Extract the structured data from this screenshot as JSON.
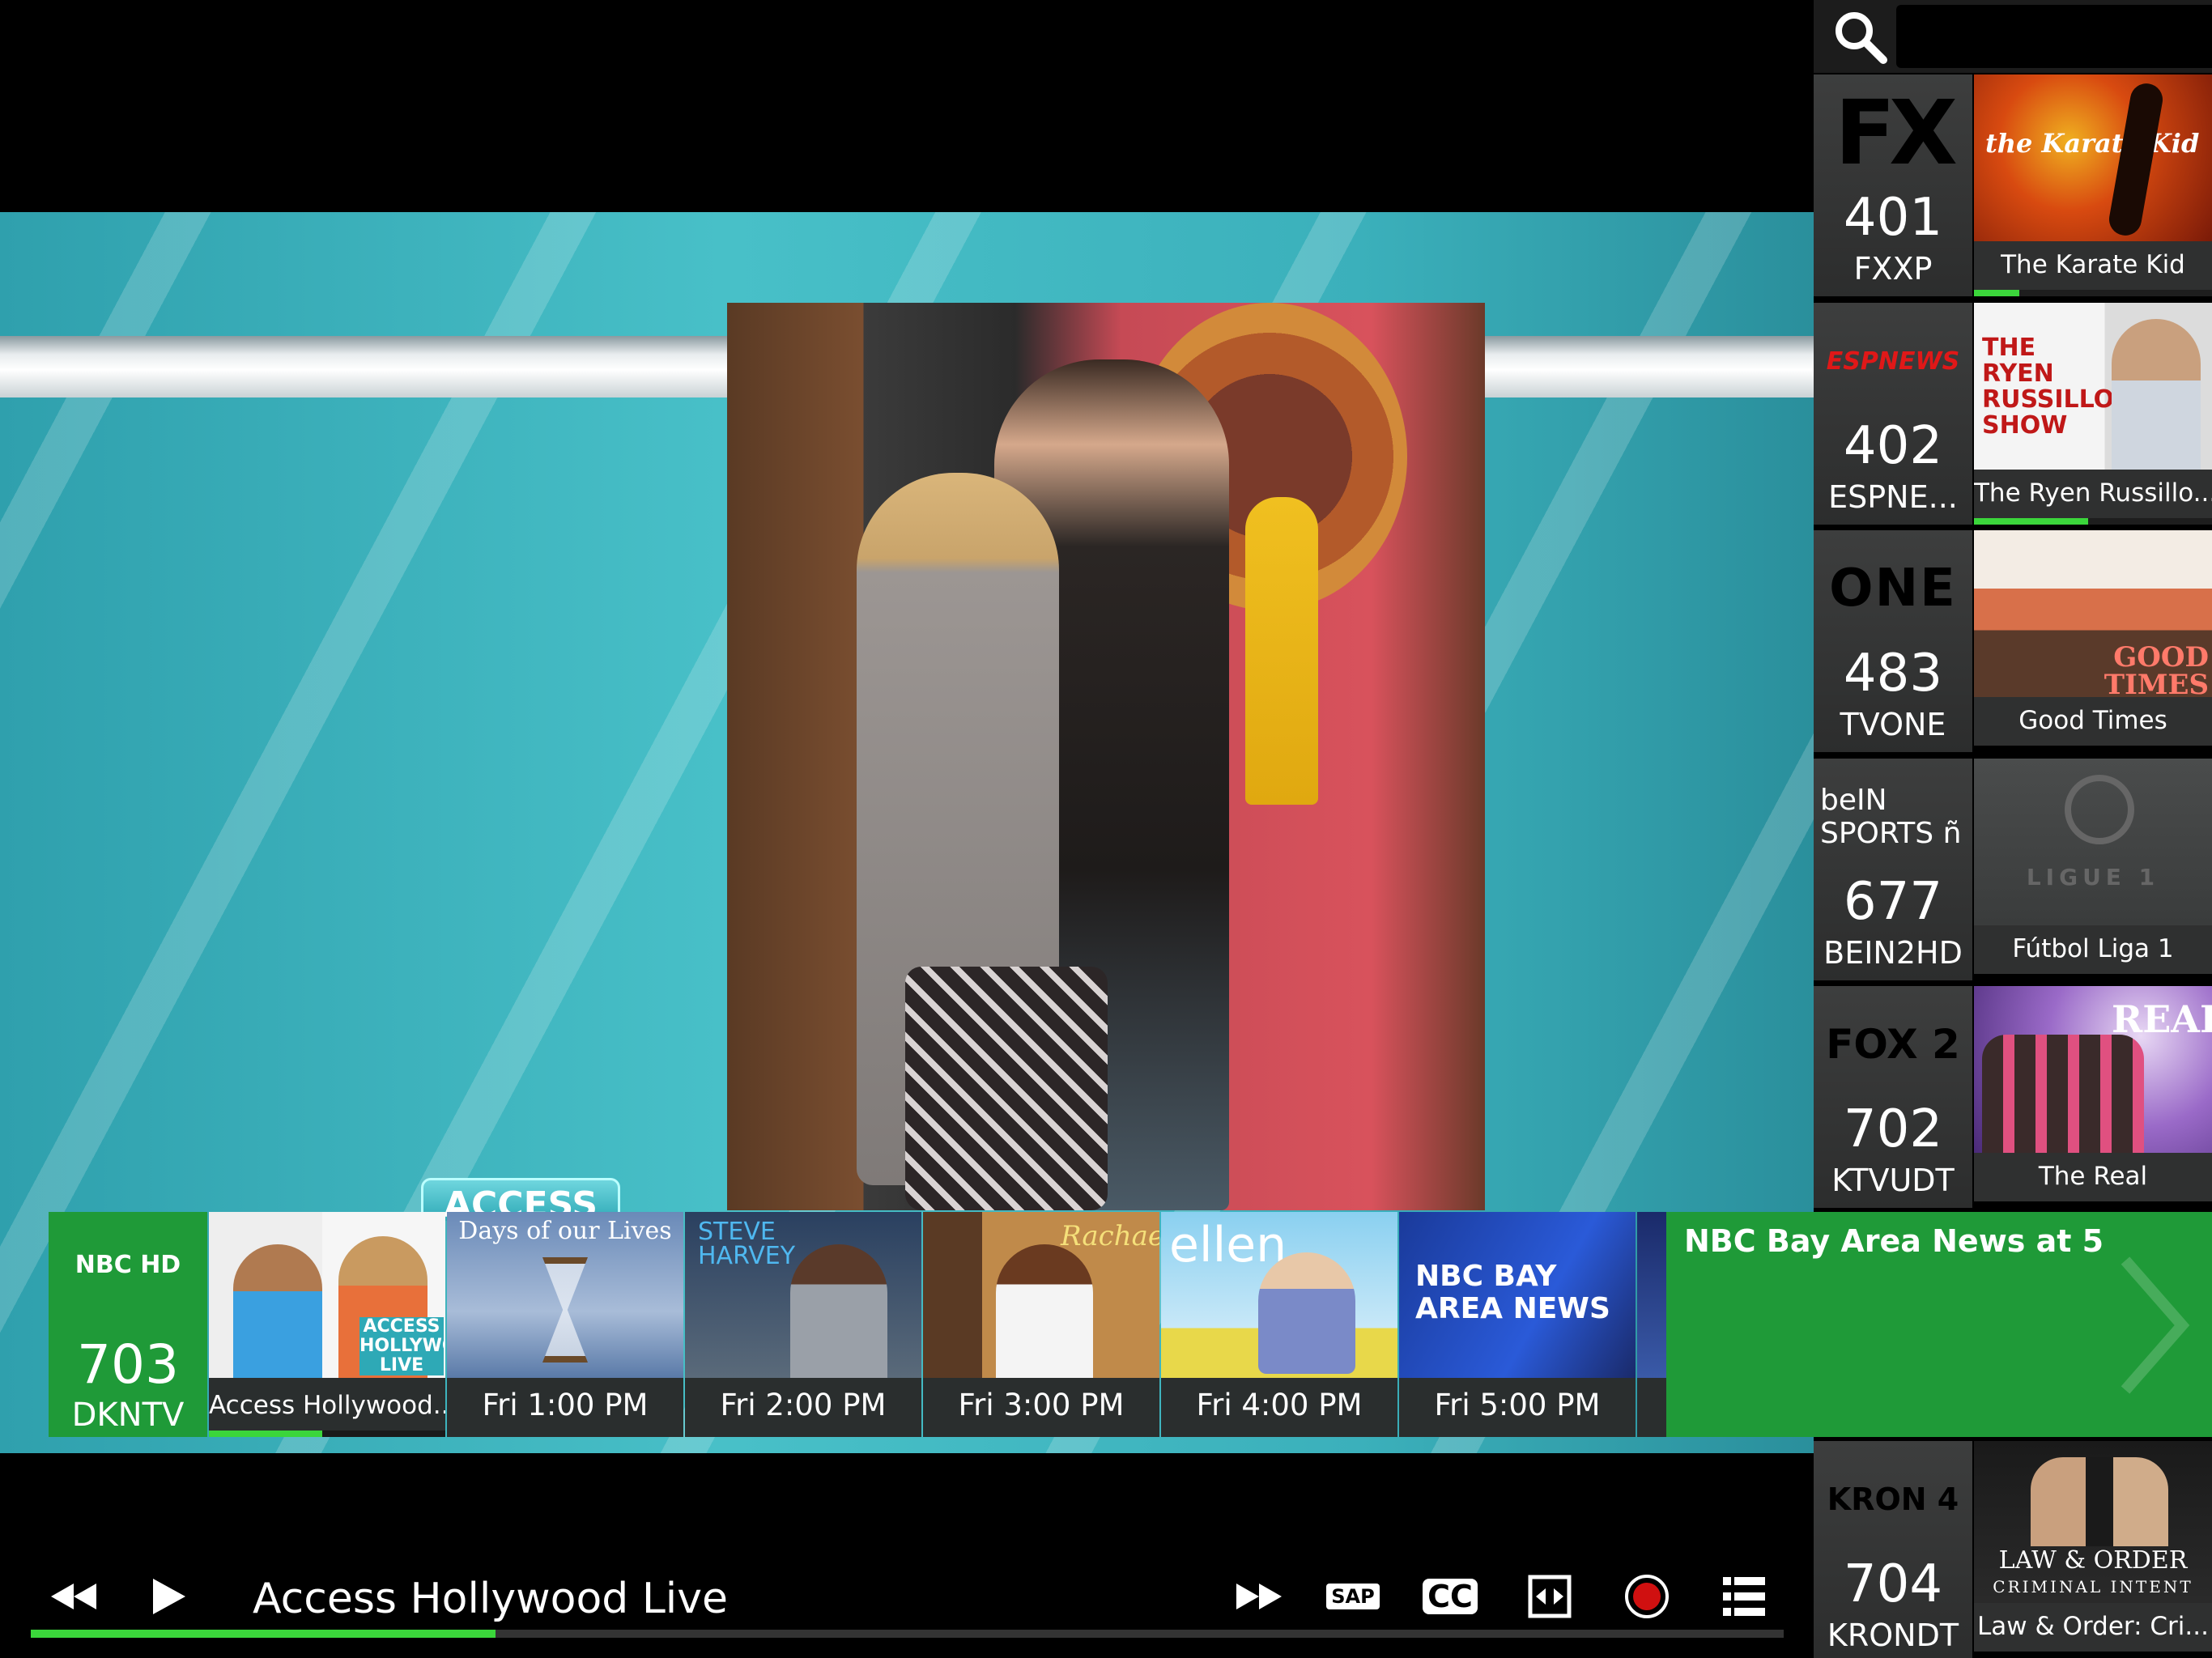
{
  "search": {
    "placeholder": ""
  },
  "video": {
    "badge_text": "ACCESS"
  },
  "channels": [
    {
      "logo": "FX",
      "number": "401",
      "callsign": "FXXP",
      "program": "The Karate Kid",
      "progress": 0.19
    },
    {
      "logo": "ESPNEWS",
      "number": "402",
      "callsign": "ESPNE...",
      "program": "The Ryen Russillo...",
      "progress": 0.48
    },
    {
      "logo": "ONE",
      "number": "483",
      "callsign": "TVONE",
      "program": "Good Times",
      "progress": 0
    },
    {
      "logo": "beIN SPORTS ñ",
      "number": "677",
      "callsign": "BEIN2HD",
      "program": "Fútbol Liga 1",
      "progress": 0
    },
    {
      "logo": "FOX 2",
      "number": "702",
      "callsign": "KTVUDT",
      "program": "The Real",
      "progress": 0
    }
  ],
  "kron": {
    "logo": "KRON 4",
    "number": "704",
    "callsign": "KRONDT",
    "program": "Law & Order: Cri..."
  },
  "thumb_text": {
    "karate": "the Karate Kid",
    "ryen": "THE RYEN RUSSILLO SHOW",
    "good_times": "GOOD TIMES",
    "ligue": "LIGUE 1",
    "real": "REAL",
    "law_order": "LAW & ORDER",
    "law_order_sub": "CRIMINAL INTENT"
  },
  "guide": {
    "channel": {
      "logo": "NBC HD",
      "number": "703",
      "callsign": "DKNTV"
    },
    "tiles": [
      {
        "label": "Access Hollywood..",
        "image_text": "ACCESS HOLLYWOOD LIVE",
        "progress": 0.48
      },
      {
        "label": "Fri 1:00 PM",
        "image_text": "Days of our Lives"
      },
      {
        "label": "Fri 2:00 PM",
        "image_text": "STEVE HARVEY"
      },
      {
        "label": "Fri 3:00 PM",
        "image_text": "Rachael"
      },
      {
        "label": "Fri 4:00 PM",
        "image_text": "ellen"
      },
      {
        "label": "Fri 5:00 PM",
        "image_text": "NBC BAY AREA NEWS"
      }
    ],
    "info_title": "NBC Bay Area News at 5"
  },
  "controls": {
    "now_playing": "Access Hollywood Live",
    "sap_label": "SAP",
    "cc_label": "CC",
    "progress": 0.265
  },
  "colors": {
    "accent_green": "#3bd63b",
    "guide_green": "#1f9a38",
    "teal": "#48c0c8",
    "record_red": "#d01010"
  }
}
